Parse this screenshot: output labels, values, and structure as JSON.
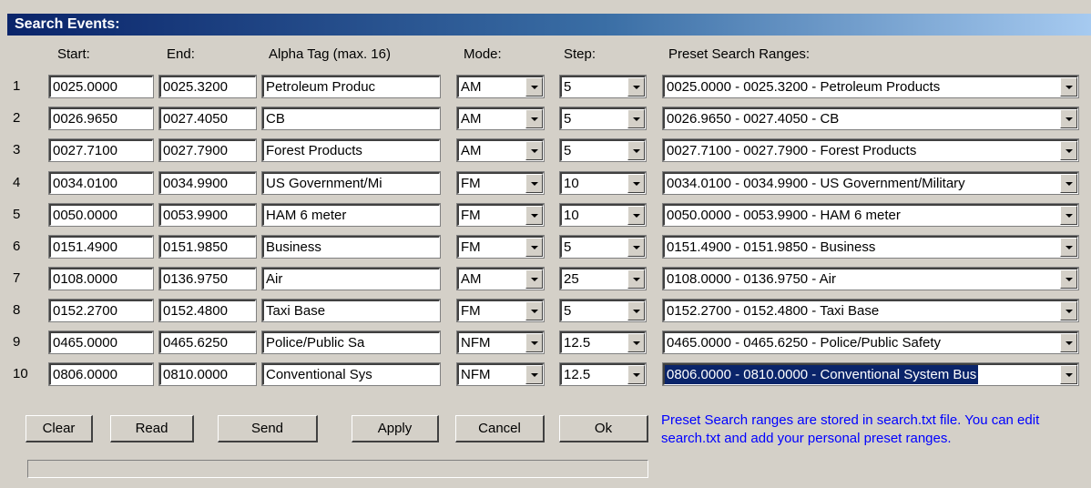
{
  "window": {
    "title": "Search Events:"
  },
  "headers": {
    "start": "Start:",
    "end": "End:",
    "alpha": "Alpha Tag (max. 16)",
    "mode": "Mode:",
    "step": "Step:",
    "preset": "Preset Search Ranges:"
  },
  "rows": [
    {
      "num": "1",
      "start": "0025.0000",
      "end": "0025.3200",
      "alpha": "Petroleum Produc",
      "mode": "AM",
      "step": "5",
      "preset": "0025.0000 - 0025.3200 - Petroleum Products"
    },
    {
      "num": "2",
      "start": "0026.9650",
      "end": "0027.4050",
      "alpha": "CB",
      "mode": "AM",
      "step": "5",
      "preset": "0026.9650 - 0027.4050 - CB"
    },
    {
      "num": "3",
      "start": "0027.7100",
      "end": "0027.7900",
      "alpha": "Forest Products",
      "mode": "AM",
      "step": "5",
      "preset": "0027.7100 - 0027.7900 - Forest Products"
    },
    {
      "num": "4",
      "start": "0034.0100",
      "end": "0034.9900",
      "alpha": "US Government/Mi",
      "mode": "FM",
      "step": "10",
      "preset": "0034.0100 - 0034.9900 - US Government/Military"
    },
    {
      "num": "5",
      "start": "0050.0000",
      "end": "0053.9900",
      "alpha": "HAM 6 meter",
      "mode": "FM",
      "step": "10",
      "preset": "0050.0000 - 0053.9900 - HAM 6 meter"
    },
    {
      "num": "6",
      "start": "0151.4900",
      "end": "0151.9850",
      "alpha": "Business",
      "mode": "FM",
      "step": "5",
      "preset": "0151.4900 - 0151.9850 - Business"
    },
    {
      "num": "7",
      "start": "0108.0000",
      "end": "0136.9750",
      "alpha": "Air",
      "mode": "AM",
      "step": "25",
      "preset": "0108.0000 - 0136.9750 - Air"
    },
    {
      "num": "8",
      "start": "0152.2700",
      "end": "0152.4800",
      "alpha": "Taxi Base",
      "mode": "FM",
      "step": "5",
      "preset": "0152.2700 - 0152.4800 - Taxi Base"
    },
    {
      "num": "9",
      "start": "0465.0000",
      "end": "0465.6250",
      "alpha": "Police/Public Sa",
      "mode": "NFM",
      "step": "12.5",
      "preset": "0465.0000 - 0465.6250 - Police/Public Safety"
    },
    {
      "num": "10",
      "start": "0806.0000",
      "end": "0810.0000",
      "alpha": "Conventional Sys",
      "mode": "NFM",
      "step": "12.5",
      "preset": "0806.0000 - 0810.0000 - Conventional System Bus",
      "selected": true
    }
  ],
  "buttons": {
    "clear": "Clear",
    "read": "Read",
    "send": "Send",
    "apply": "Apply",
    "cancel": "Cancel",
    "ok": "Ok"
  },
  "info_text": "Preset Search ranges are stored in search.txt file. You can edit search.txt and add your personal preset ranges.",
  "progress": 0,
  "colors": {
    "title_gradient_start": "#0a246a",
    "title_gradient_end": "#a6caf0",
    "info_text": "#0000ff",
    "selection": "#0a246a"
  }
}
